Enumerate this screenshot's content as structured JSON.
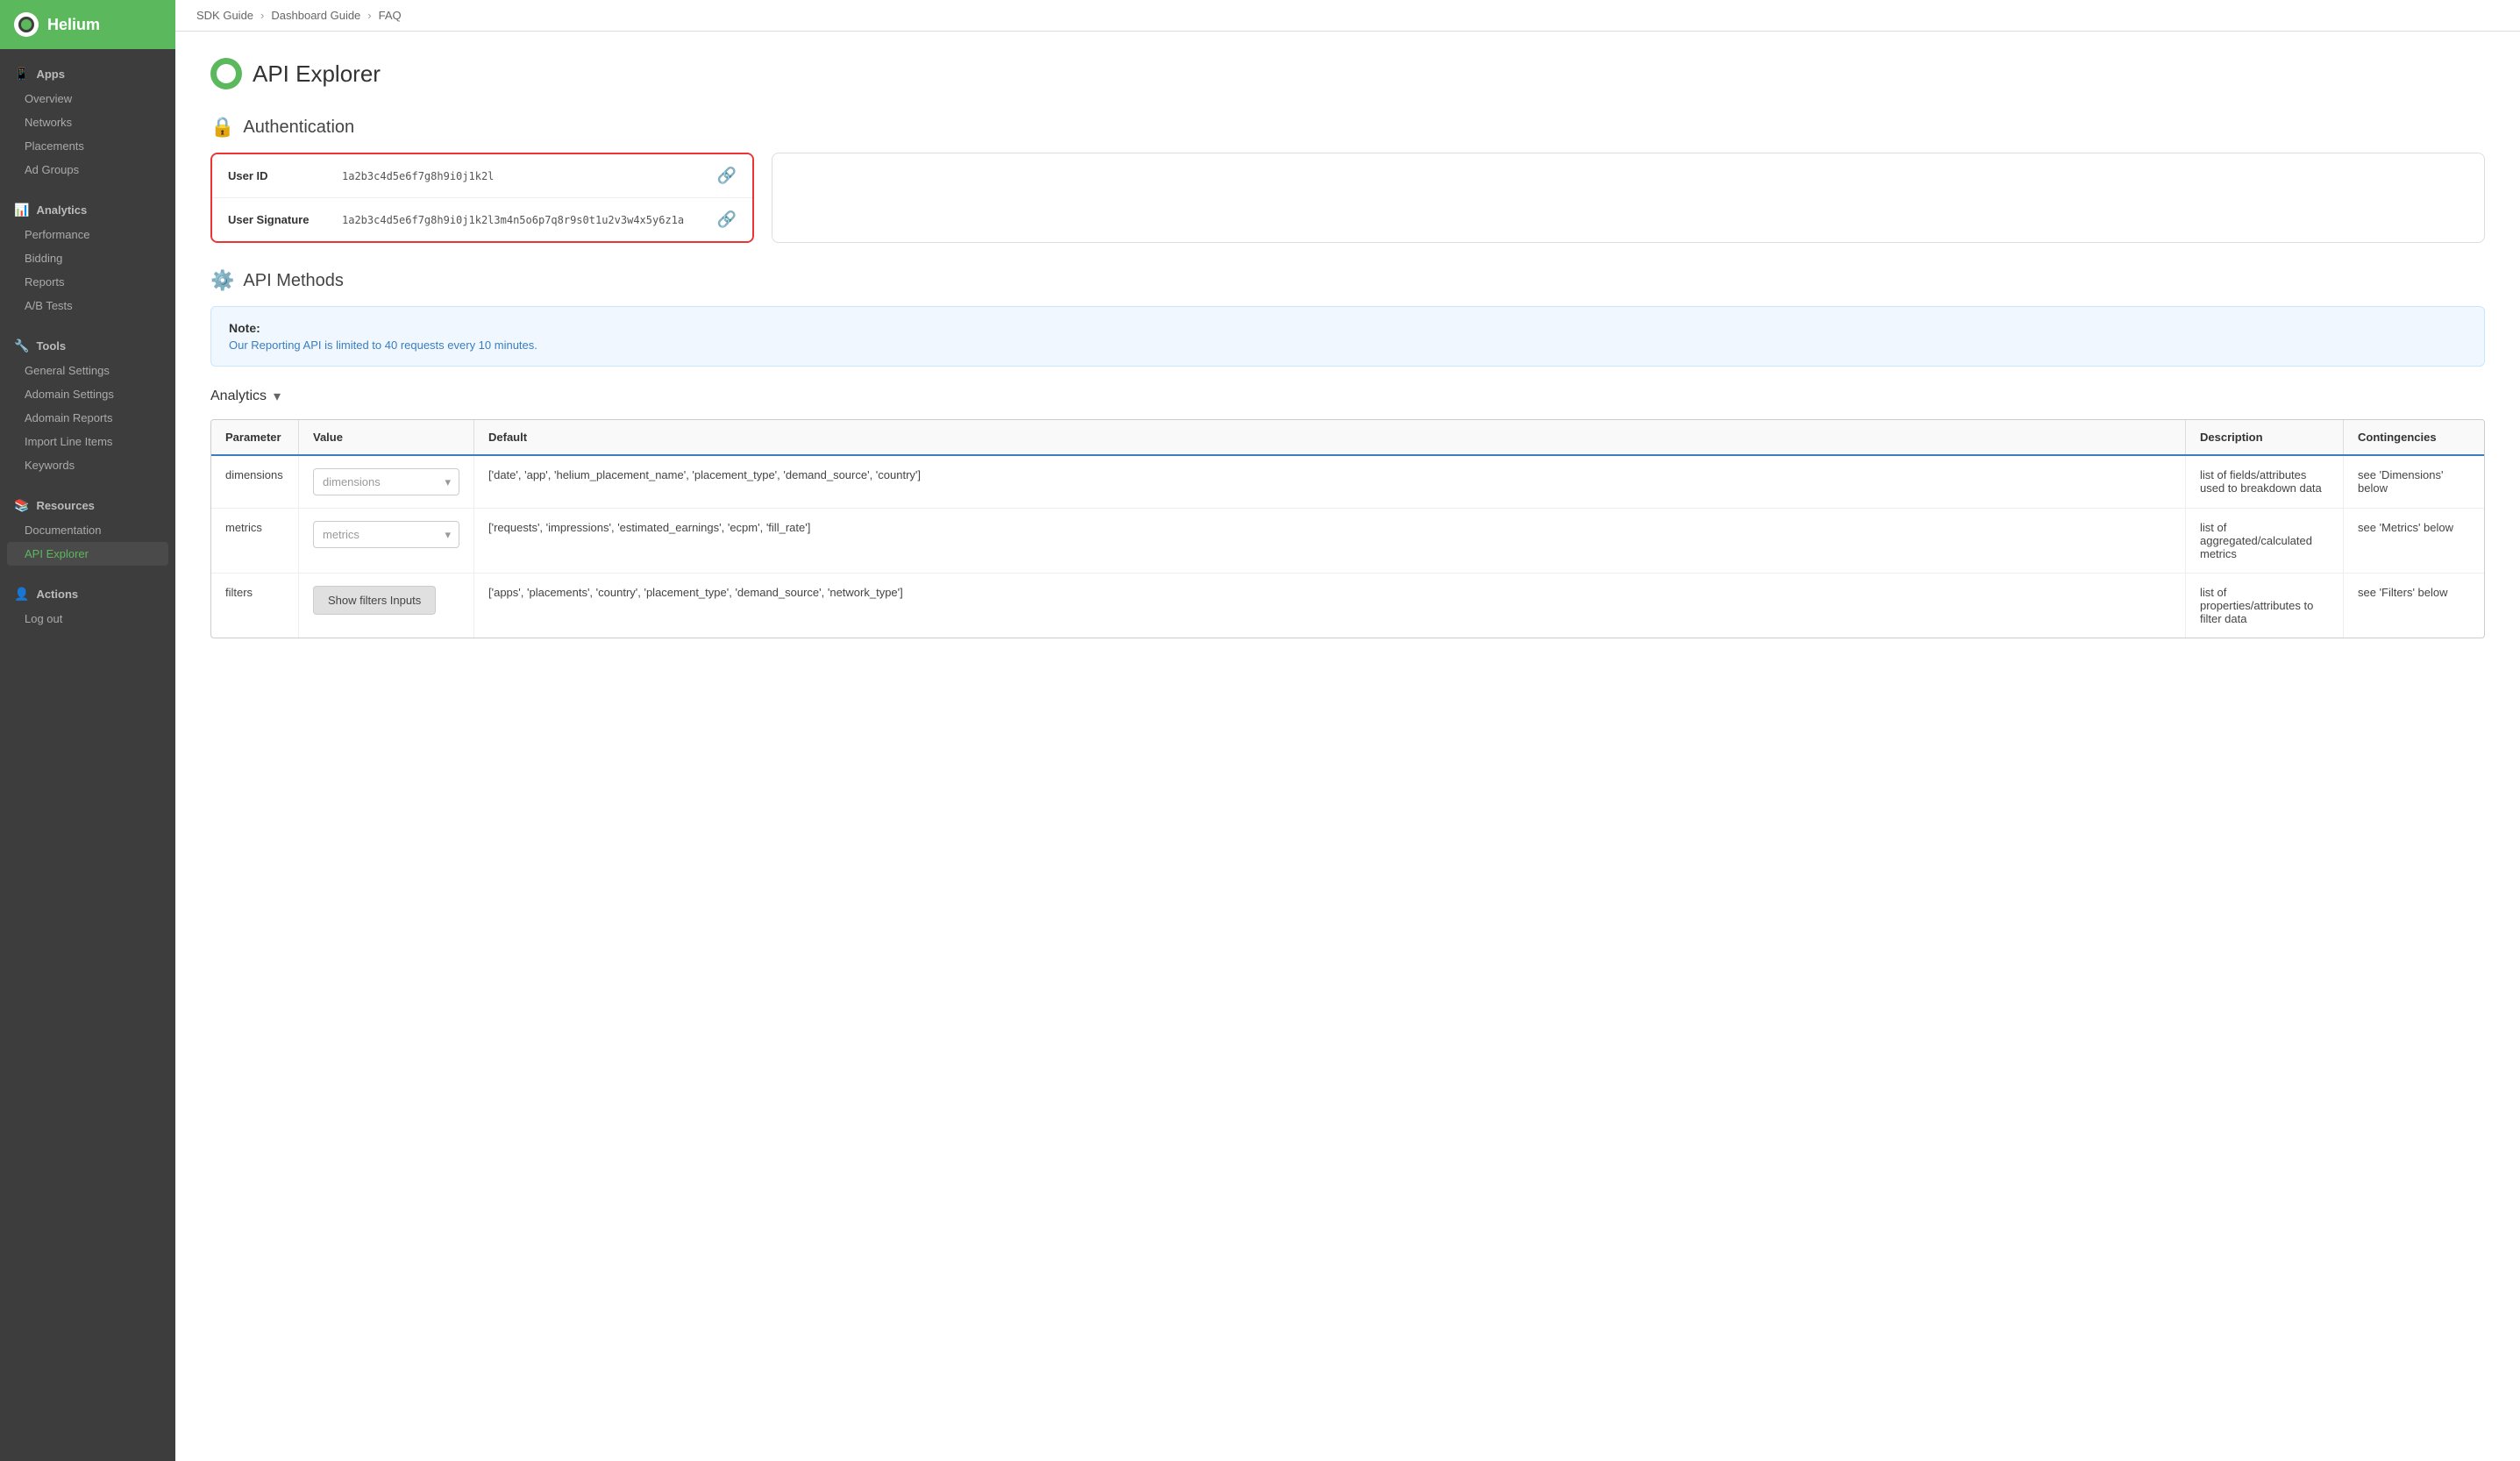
{
  "app": {
    "name": "Helium"
  },
  "breadcrumb": {
    "items": [
      "SDK Guide",
      "Dashboard Guide",
      "FAQ"
    ]
  },
  "sidebar": {
    "sections": [
      {
        "id": "apps",
        "label": "Apps",
        "icon": "📱",
        "items": [
          "Overview",
          "Networks",
          "Placements",
          "Ad Groups"
        ]
      },
      {
        "id": "analytics",
        "label": "Analytics",
        "icon": "📊",
        "items": [
          "Performance",
          "Bidding",
          "Reports",
          "A/B Tests"
        ]
      },
      {
        "id": "tools",
        "label": "Tools",
        "icon": "🔧",
        "items": [
          "General Settings",
          "Adomain Settings",
          "Adomain Reports",
          "Import Line Items",
          "Keywords"
        ]
      },
      {
        "id": "resources",
        "label": "Resources",
        "icon": "📚",
        "items": [
          "Documentation",
          "API Explorer"
        ]
      },
      {
        "id": "actions",
        "label": "Actions",
        "icon": "👤",
        "items": [
          "Log out"
        ]
      }
    ],
    "active_item": "API Explorer"
  },
  "page": {
    "title": "API Explorer",
    "auth_section": {
      "title": "Authentication",
      "user_id_label": "User ID",
      "user_id_value": "1a2b3c4d5e6f7g8h9i0j1k2l",
      "user_signature_label": "User Signature",
      "user_signature_value": "1a2b3c4d5e6f7g8h9i0j1k2l3m4n5o6p7q8r9s0t1u2v3w4x5y6z1a"
    },
    "api_methods_section": {
      "title": "API Methods",
      "note_title": "Note:",
      "note_body": "Our Reporting API is limited to 40 requests every 10 minutes."
    },
    "analytics_toggle": {
      "label": "Analytics",
      "arrow": "▾"
    },
    "table": {
      "headers": [
        "Parameter",
        "Value",
        "Default",
        "Description",
        "Contingencies"
      ],
      "rows": [
        {
          "parameter": "dimensions",
          "value_placeholder": "dimensions",
          "default": "['date', 'app', 'helium_placement_name', 'placement_type', 'demand_source', 'country']",
          "description": "list of fields/attributes used to breakdown data",
          "contingencies": "see 'Dimensions' below"
        },
        {
          "parameter": "metrics",
          "value_placeholder": "metrics",
          "default": "['requests', 'impressions', 'estimated_earnings', 'ecpm', 'fill_rate']",
          "description": "list of aggregated/calculated metrics",
          "contingencies": "see 'Metrics' below"
        },
        {
          "parameter": "filters",
          "value_button": "Show filters Inputs",
          "default": "['apps', 'placements', 'country', 'placement_type', 'demand_source', 'network_type']",
          "description": "list of properties/attributes to filter data",
          "contingencies": "see 'Filters' below"
        }
      ]
    }
  }
}
